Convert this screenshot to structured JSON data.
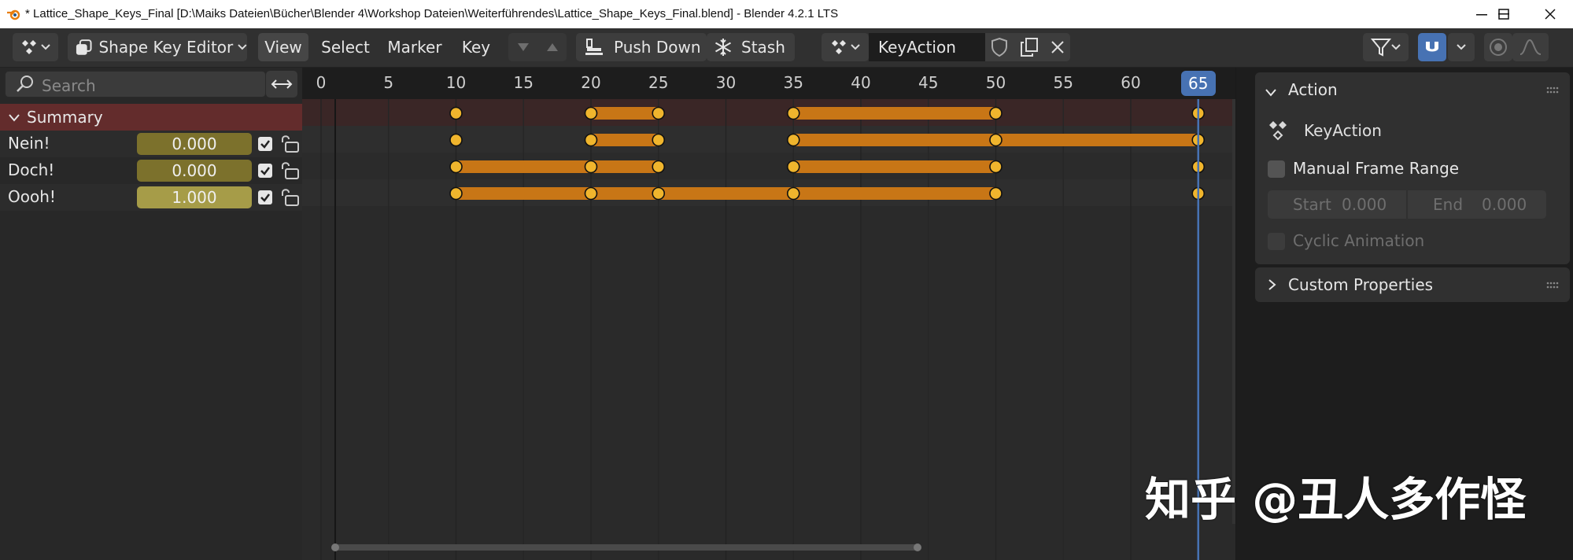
{
  "window": {
    "title": "* Lattice_Shape_Keys_Final [D:\\Maiks Dateien\\Bücher\\Blender 4\\Workshop Dateien\\Weiterführendes\\Lattice_Shape_Keys_Final.blend] - Blender 4.2.1 LTS"
  },
  "header": {
    "editor_mode": "Shape Key Editor",
    "menus": [
      "View",
      "Select",
      "Marker",
      "Key"
    ],
    "push_down": "Push Down",
    "stash": "Stash",
    "action_name": "KeyAction"
  },
  "channels": {
    "search_placeholder": "Search",
    "summary": "Summary",
    "rows": [
      {
        "name": "Nein!",
        "value": "0.000"
      },
      {
        "name": "Doch!",
        "value": "0.000"
      },
      {
        "name": "Oooh!",
        "value": "1.000"
      }
    ]
  },
  "ruler": {
    "labels": [
      "0",
      "5",
      "10",
      "15",
      "20",
      "25",
      "30",
      "35",
      "40",
      "45",
      "50",
      "55",
      "60"
    ],
    "current_frame": "65"
  },
  "keyframes": {
    "current_frame": 65,
    "rows": [
      {
        "channel": "Summary",
        "keys": [
          10,
          20,
          25,
          35,
          50,
          65
        ],
        "holds": [
          [
            20,
            25
          ],
          [
            35,
            50
          ]
        ]
      },
      {
        "channel": "Nein!",
        "keys": [
          10,
          20,
          25,
          35,
          50,
          65
        ],
        "holds": [
          [
            20,
            25
          ],
          [
            35,
            65
          ]
        ]
      },
      {
        "channel": "Doch!",
        "keys": [
          10,
          20,
          25,
          35,
          50,
          65
        ],
        "holds": [
          [
            10,
            25
          ],
          [
            35,
            50
          ]
        ]
      },
      {
        "channel": "Oooh!",
        "keys": [
          10,
          20,
          25,
          35,
          50,
          65
        ],
        "holds": [
          [
            10,
            50
          ]
        ]
      }
    ]
  },
  "sidebar": {
    "action_panel": {
      "title": "Action",
      "action_name": "KeyAction",
      "manual_frame_range": "Manual Frame Range",
      "start_label": "Start",
      "start_value": "0.000",
      "end_label": "End",
      "end_value": "0.000",
      "cyclic": "Cyclic Animation"
    },
    "custom_properties": "Custom Properties"
  },
  "watermark": "知乎 @丑人多作怪",
  "colors": {
    "keyframe_fill": "#f0b52d",
    "hold_bar": "#c87616",
    "playhead": "#4772b3",
    "summary_bg": "#632c2c"
  }
}
